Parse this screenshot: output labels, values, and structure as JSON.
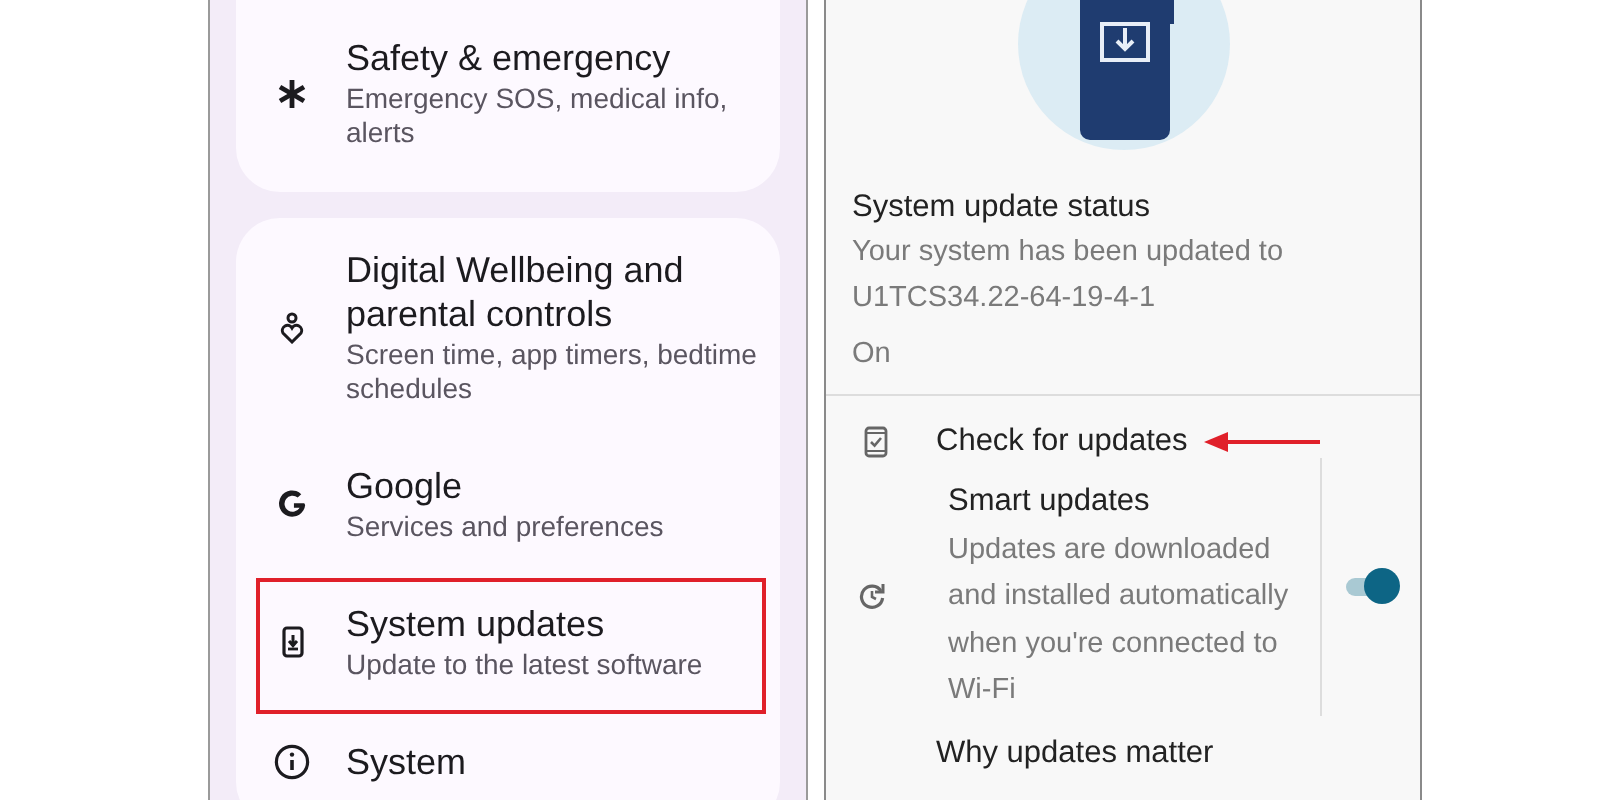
{
  "settings_list": {
    "cards": [
      {
        "items": [
          {
            "title": "Safety & emergency",
            "subtitle": "Emergency SOS, medical info, alerts",
            "highlighted": false
          }
        ]
      },
      {
        "items": [
          {
            "title": "Digital Wellbeing and parental controls",
            "subtitle": "Screen time, app timers, bedtime schedules",
            "highlighted": false
          },
          {
            "title": "Google",
            "subtitle": "Services and preferences",
            "highlighted": false
          },
          {
            "title": "System updates",
            "subtitle": "Update to the latest software",
            "highlighted": true
          },
          {
            "title": "System",
            "highlighted": false
          }
        ]
      }
    ]
  },
  "system_update": {
    "status": {
      "title": "System update status",
      "lines": [
        "Your system has been updated to",
        "U1TCS34.22-64-19-4-1"
      ],
      "state": "On"
    },
    "check_updates": {
      "label": "Check for updates",
      "pointed_at": true
    },
    "smart_updates": {
      "title": "Smart updates",
      "description": "Updates are downloaded and installed automatically when you're connected to Wi-Fi",
      "on": true
    },
    "why_updates": {
      "title": "Why updates matter"
    }
  }
}
